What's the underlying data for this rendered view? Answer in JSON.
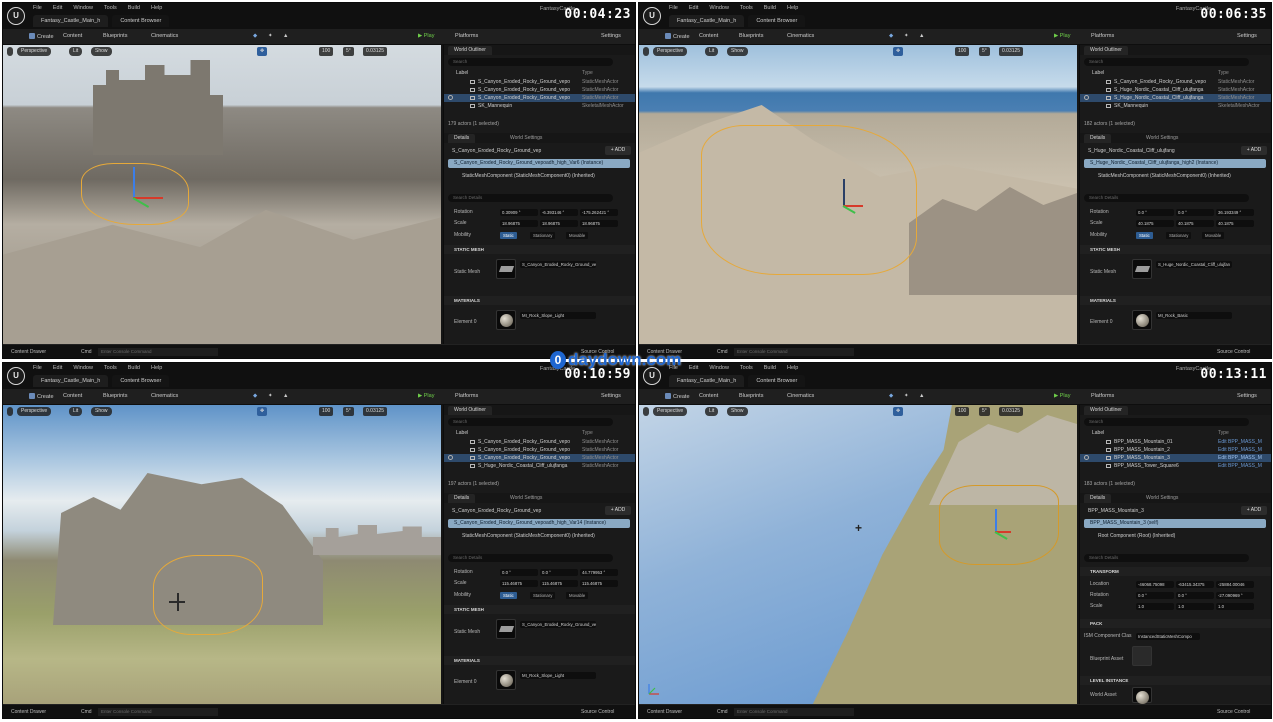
{
  "watermark": "daydown.com",
  "watermark_o": "0",
  "ui": {
    "menus": [
      "File",
      "Edit",
      "Window",
      "Tools",
      "Build",
      "Help"
    ],
    "level_tab": "Fantasy_Castle_Main_h",
    "content_browser_tab": "Content Browser",
    "project": "FantasyCastle",
    "toolbar": {
      "create": "Create",
      "content": "Content",
      "blueprints": "Blueprints",
      "cinematics": "Cinematics",
      "play": "Play",
      "platforms": "Platforms",
      "settings": "Settings"
    },
    "viewport": {
      "perspective": "Perspective",
      "lit": "Lit",
      "show": "Show",
      "grid": "100",
      "angle": "5°",
      "scale": "0.03125"
    },
    "outliner": {
      "title": "World Outliner",
      "search": "Search",
      "col_label": "Label",
      "col_type": "Type"
    },
    "details": {
      "title": "Details",
      "world_settings": "World Settings",
      "add": "+ ADD",
      "search": "Search Details",
      "rotation": "Rotation",
      "scale": "Scale",
      "location": "Location",
      "mobility": "Mobility",
      "static": "Static",
      "stationary": "Stationary",
      "movable": "Movable",
      "static_mesh_section": "STATIC MESH",
      "static_mesh": "Static Mesh",
      "materials_section": "MATERIALS",
      "element": "Element 0",
      "transform_section": "TRANSFORM",
      "pack_section": "PACK",
      "ism_label": "ISM Component Clas",
      "ism_value": "InstancedStaticMeshCompo",
      "blueprint_asset": "Blueprint Asset",
      "level_instance_section": "LEVEL INSTANCE",
      "world_asset": "World Asset"
    },
    "status": {
      "content_drawer": "Content Drawer",
      "cmd": "Cmd",
      "console": "Enter Console Command",
      "source_control": "Source Control"
    }
  },
  "quadrants": [
    {
      "timestamp": "00:04:23",
      "outliner_rows": [
        {
          "label": "S_Canyon_Eroded_Rocky_Ground_vepo",
          "type": "StaticMeshActor",
          "selected": false
        },
        {
          "label": "S_Canyon_Eroded_Rocky_Ground_vepo",
          "type": "StaticMeshActor",
          "selected": false
        },
        {
          "label": "S_Canyon_Eroded_Rocky_Ground_vepo",
          "type": "StaticMeshActor",
          "selected": true
        },
        {
          "label": "SK_Mannequin",
          "type": "SkeletalMeshActor",
          "selected": false
        }
      ],
      "actor_count": "179 actors (1 selected)",
      "details_name": "S_Canyon_Eroded_Rocky_Ground_vep",
      "instance": "S_Canyon_Eroded_Rocky_Ground_vepoadh_high_Var6 (Instance)",
      "component": "StaticMeshComponent (StaticMeshComponent0) (Inherited)",
      "rotation": [
        "0.30909 °",
        "-6.393146 °",
        "-175.262421 °"
      ],
      "scale": [
        "18.96875",
        "18.96875",
        "18.96875"
      ],
      "mesh": "S_Canyon_Eroded_Rocky_Ground_ve",
      "material": "MI_Rock_Slope_Light"
    },
    {
      "timestamp": "00:06:35",
      "outliner_rows": [
        {
          "label": "S_Canyon_Eroded_Rocky_Ground_vepo",
          "type": "StaticMeshActor",
          "selected": false
        },
        {
          "label": "S_Huge_Nordic_Coastal_Cliff_ulujfanga",
          "type": "StaticMeshActor",
          "selected": false
        },
        {
          "label": "S_Huge_Nordic_Coastal_Cliff_ulujfanga",
          "type": "StaticMeshActor",
          "selected": true
        },
        {
          "label": "SK_Mannequin",
          "type": "SkeletalMeshActor",
          "selected": false
        }
      ],
      "actor_count": "182 actors (1 selected)",
      "details_name": "S_Huge_Nordic_Coastal_Cliff_ulujfang",
      "instance": "S_Huge_Nordic_Coastal_Cliff_ulujfanga_high2 (Instance)",
      "component": "StaticMeshComponent (StaticMeshComponent0) (Inherited)",
      "rotation": [
        "0.0 °",
        "0.0 °",
        "36.193349 °"
      ],
      "scale": [
        "40.1875",
        "40.1875",
        "40.1875"
      ],
      "mesh": "S_Huge_Nordic_Coastal_Cliff_ulujfan",
      "material": "MI_Rock_Basic"
    },
    {
      "timestamp": "00:10:59",
      "outliner_rows": [
        {
          "label": "S_Canyon_Eroded_Rocky_Ground_vepo",
          "type": "StaticMeshActor",
          "selected": false
        },
        {
          "label": "S_Canyon_Eroded_Rocky_Ground_vepo",
          "type": "StaticMeshActor",
          "selected": false
        },
        {
          "label": "S_Canyon_Eroded_Rocky_Ground_vepo",
          "type": "StaticMeshActor",
          "selected": true
        },
        {
          "label": "S_Huge_Nordic_Coastal_Cliff_ulujfanga",
          "type": "StaticMeshActor",
          "selected": false
        }
      ],
      "actor_count": "197 actors (1 selected)",
      "details_name": "S_Canyon_Eroded_Rocky_Ground_vep",
      "instance": "S_Canyon_Eroded_Rocky_Ground_vepoadh_high_Var14 (Instance)",
      "component": "StaticMeshComponent (StaticMeshComponent0) (Inherited)",
      "rotation": [
        "0.0 °",
        "0.0 °",
        "44.779953 °"
      ],
      "scale": [
        "115.46875",
        "115.46875",
        "115.46875"
      ],
      "mesh": "S_Canyon_Eroded_Rocky_Ground_ve",
      "material": "MI_Rock_Slope_Light"
    },
    {
      "timestamp": "00:13:11",
      "outliner_rows": [
        {
          "label": "BPP_MASS_Mountain_01",
          "type": "Edit BPP_MASS_M",
          "selected": false
        },
        {
          "label": "BPP_MASS_Mountain_2",
          "type": "Edit BPP_MASS_M",
          "selected": false
        },
        {
          "label": "BPP_MASS_Mountain_3",
          "type": "Edit BPP_MASS_M",
          "selected": true
        },
        {
          "label": "BPP_MASS_Tower_Square6",
          "type": "Edit BPP_MASS_M",
          "selected": false
        }
      ],
      "actor_count": "183 actors (1 selected)",
      "details_name": "BPP_MASS_Mountain_3",
      "instance": "BPP_MASS_Mountain_3 (self)",
      "component": "Root Component (Root) (Inherited)",
      "location": [
        "-46068.75098",
        "-63415.34375",
        "-25884.00046"
      ],
      "rotation": [
        "0.0 °",
        "0.0 °",
        "-27.090969 °"
      ],
      "scale": [
        "1.0",
        "1.0",
        "1.0"
      ]
    }
  ]
}
